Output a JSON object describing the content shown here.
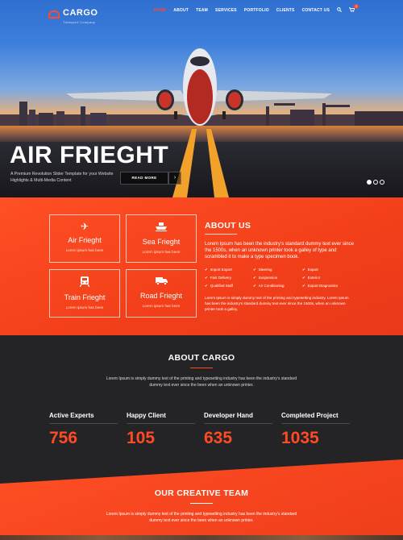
{
  "brand": {
    "name": "CARGO",
    "tagline": "Transport Company",
    "accent": "#ff4a24",
    "dark_bg": "#242426"
  },
  "nav": {
    "items": [
      {
        "label": "HOME",
        "active": true
      },
      {
        "label": "ABOUT"
      },
      {
        "label": "TEAM"
      },
      {
        "label": "SERVICES"
      },
      {
        "label": "PORTFOLIO"
      },
      {
        "label": "CLIENTS"
      },
      {
        "label": "CONTACT US"
      }
    ],
    "search_icon": "search-icon",
    "cart_icon": "cart-icon",
    "cart_count": "0"
  },
  "hero": {
    "title": "AIR FRIEGHT",
    "subtitle": "A Premium Revolution Slider Template for your Website Highlights & Multi-Media Content",
    "read_more": "READ MORE",
    "arrow": "›",
    "slides": 3,
    "active_slide": 1
  },
  "services": [
    {
      "title": "Air Frieght",
      "desc": "Lorem ipsum has been",
      "icon": "plane-icon",
      "glyph": "✈"
    },
    {
      "title": "Sea Frieght",
      "desc": "Lorem ipsum has been",
      "icon": "ship-icon",
      "glyph": "⛴"
    },
    {
      "title": "Train Frieght",
      "desc": "Lorem ipsum has been",
      "icon": "train-icon",
      "glyph": "🚆"
    },
    {
      "title": "Road Frieght",
      "desc": "Lorem ipsum has been",
      "icon": "truck-icon",
      "glyph": "🚚"
    }
  ],
  "about": {
    "heading": "ABOUT US",
    "text": "Lorem Ipsum has been the industry's standard dummy text ever since the 1500s, when an unknown printer took a galley of type and scrambled it to make a type specimen book.",
    "features": [
      "Import Export",
      "Steering",
      "Export",
      "Fast Delivery",
      "Suspension",
      "Exterior",
      "Qualified Staff",
      "Air Conditioning",
      "Export Diagnostics"
    ],
    "text2": "Lorem Ipsum is simply dummy text of the printing and typesetting industry. Lorem Ipsum has been the industry's standard dummy text ever since the 1500s, when an unknown printer took a galley."
  },
  "about_cargo": {
    "heading": "ABOUT CARGO",
    "text": "Lorem Ipsum is simply dummy text of the printing and typesetting industry has been the industry's standard dummy text ever since the been when an unknown printer.",
    "stats": [
      {
        "label": "Active Experts",
        "value": "756"
      },
      {
        "label": "Happy Client",
        "value": "105"
      },
      {
        "label": "Developer Hand",
        "value": "635"
      },
      {
        "label": "Completed Project",
        "value": "1035"
      }
    ]
  },
  "team": {
    "heading": "OUR CREATIVE TEAM",
    "text": "Lorem Ipsum is simply dummy text of the printing and typesetting industry has been the industry's standard dummy text ever since the been when an unknown printer."
  }
}
